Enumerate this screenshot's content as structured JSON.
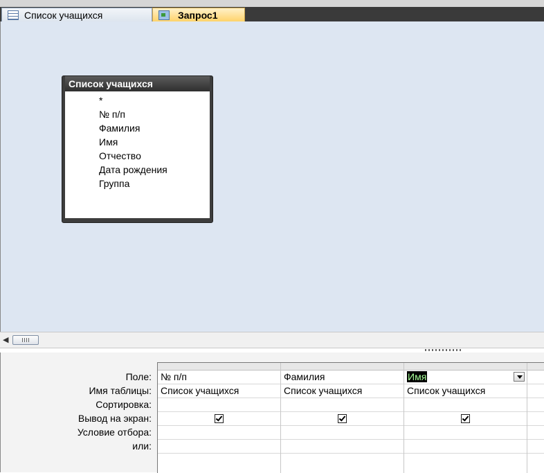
{
  "tabs": [
    {
      "label": "Список учащихся",
      "icon": "table-icon"
    },
    {
      "label": "Запрос1",
      "icon": "query-icon"
    }
  ],
  "field_list": {
    "title": "Список учащихся",
    "fields": [
      "*",
      "№ п/п",
      "Фамилия",
      "Имя",
      "Отчество",
      "Дата рождения",
      "Группа"
    ]
  },
  "qbe": {
    "row_labels": {
      "field": "Поле:",
      "table": "Имя таблицы:",
      "sort": "Сортировка:",
      "show": "Вывод на экран:",
      "criteria": "Условие отбора:",
      "or": "или:"
    },
    "columns": [
      {
        "field": "№ п/п",
        "table": "Список учащихся",
        "show": true
      },
      {
        "field": "Фамилия",
        "table": "Список учащихся",
        "show": true
      },
      {
        "field": "Имя",
        "table": "Список учащихся",
        "show": true
      }
    ]
  }
}
